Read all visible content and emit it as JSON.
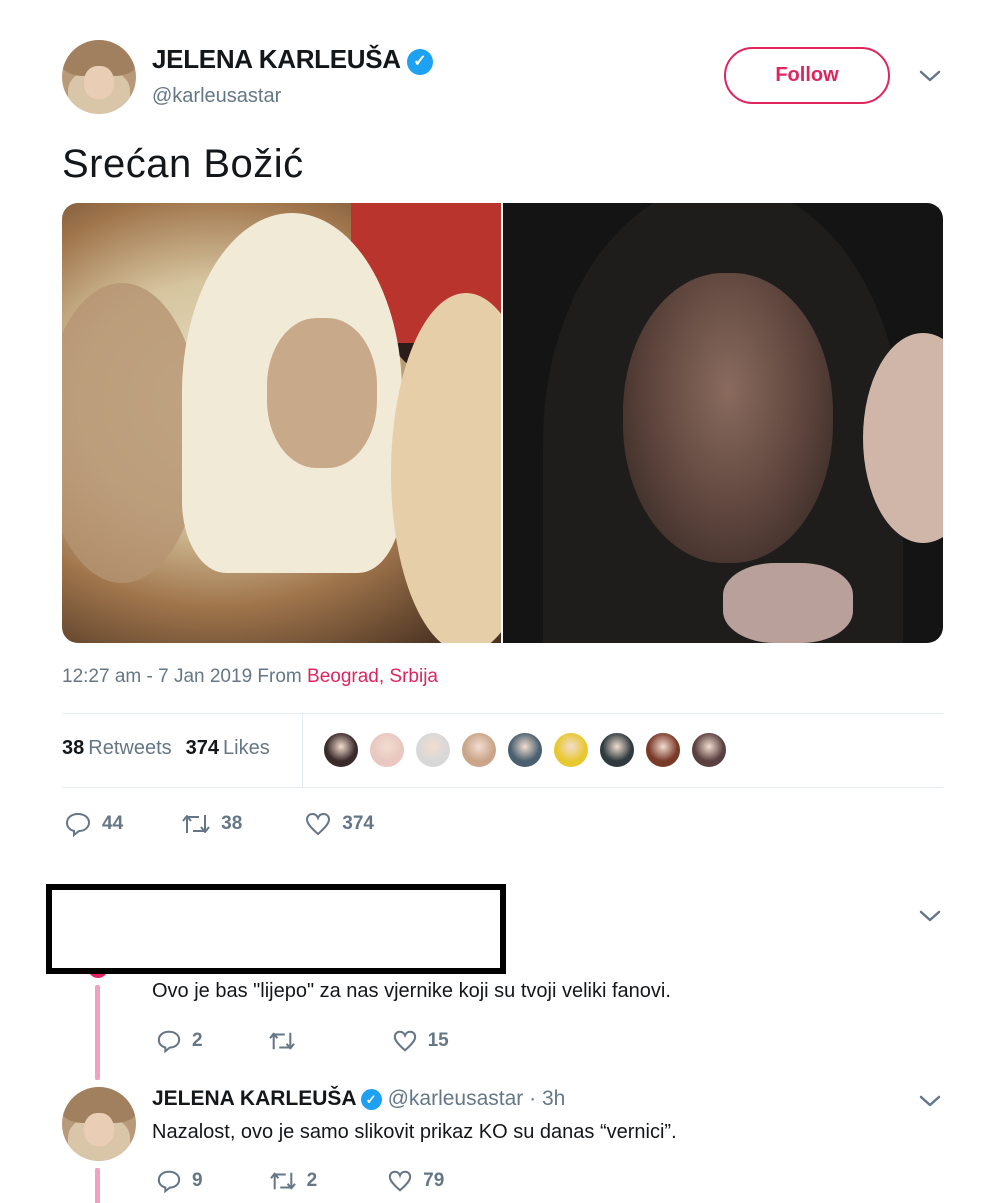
{
  "tweet": {
    "author_name": "JELENA KARLEUŠA",
    "verified_mark": "✓",
    "handle": "@karleusastar",
    "follow_label": "Follow",
    "text": "Srećan Božić",
    "time_prefix": "12:27 am - 7 Jan 2019 From ",
    "location": "Beograd, Srbija",
    "retweets_count": "38",
    "retweets_label": "Retweets",
    "likes_count": "374",
    "likes_label": "Likes",
    "likers_colors": [
      "#3a2a2a",
      "#e8c8c0",
      "#d8d8d8",
      "#caa58a",
      "#4a6070",
      "#e8c830",
      "#2f3a3f",
      "#7a3a2a",
      "#5a4040"
    ],
    "actions": {
      "reply": "44",
      "retweet": "38",
      "like": "374"
    }
  },
  "replies": [
    {
      "text": "Ovo je bas \"lijepo\" za nas vjernike koji su tvoji veliki fanovi.",
      "actions": {
        "reply": "2",
        "retweet": "",
        "like": "15"
      }
    },
    {
      "author_name": "JELENA KARLEUŠA",
      "meta": "@karleusastar · 3h",
      "text": "Nazalost, ovo je samo slikovit prikaz KO su danas “vernici”.",
      "actions": {
        "reply": "9",
        "retweet": "2",
        "like": "79"
      }
    }
  ],
  "colors": {
    "accent": "#e0245e",
    "verified": "#1da1f2",
    "muted": "#657786",
    "thread": "#f0a0c0"
  }
}
